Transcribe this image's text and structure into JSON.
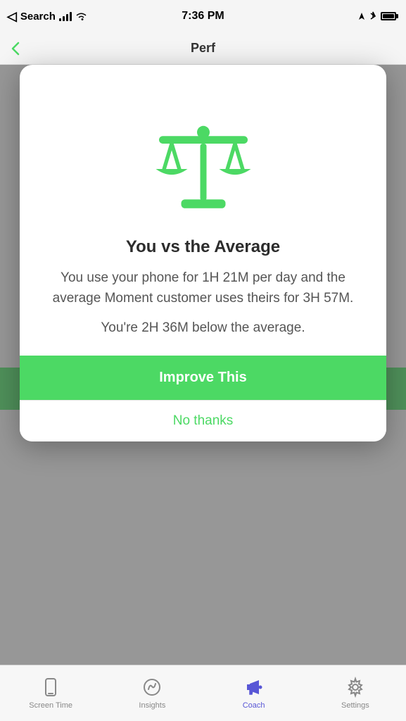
{
  "statusBar": {
    "carrier": "Search",
    "time": "7:36 PM",
    "battery": "full"
  },
  "navBar": {
    "backLabel": "Back",
    "title": "Perf"
  },
  "modal": {
    "title": "You vs the Average",
    "bodyText": "You use your phone for 1H 21M per day and the average Moment customer uses theirs for 3H 57M.",
    "comparisonText": "You're 2H 36M below the average.",
    "improveButtonLabel": "Improve This",
    "noThanksLabel": "No thanks"
  },
  "tabBar": {
    "items": [
      {
        "label": "Screen Time",
        "icon": "phone-icon",
        "active": false
      },
      {
        "label": "Insights",
        "icon": "insights-icon",
        "active": false
      },
      {
        "label": "Coach",
        "icon": "coach-icon",
        "active": true
      },
      {
        "label": "Settings",
        "icon": "settings-icon",
        "active": false
      }
    ]
  }
}
